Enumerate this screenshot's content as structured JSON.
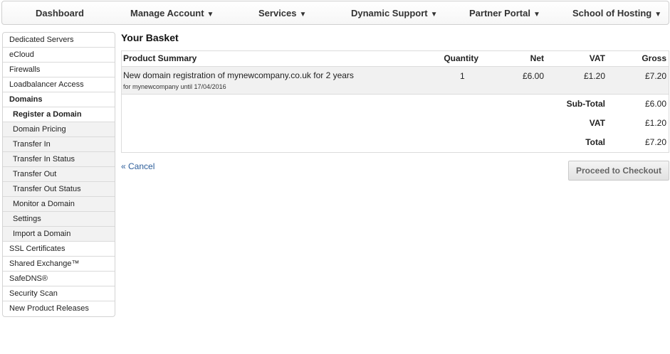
{
  "nav": {
    "items": [
      {
        "label": "Dashboard",
        "caret": ""
      },
      {
        "label": "Manage Account",
        "caret": "▼"
      },
      {
        "label": "Services",
        "caret": "▼"
      },
      {
        "label": "Dynamic Support",
        "caret": "▼"
      },
      {
        "label": "Partner Portal",
        "caret": "▼"
      },
      {
        "label": "School of Hosting",
        "caret": "▼"
      }
    ]
  },
  "sidebar": {
    "items": [
      {
        "label": "Dedicated Servers"
      },
      {
        "label": "eCloud"
      },
      {
        "label": "Firewalls"
      },
      {
        "label": "Loadbalancer Access"
      },
      {
        "label": "Domains"
      },
      {
        "label": "Register a Domain"
      },
      {
        "label": "Domain Pricing"
      },
      {
        "label": "Transfer In"
      },
      {
        "label": "Transfer In Status"
      },
      {
        "label": "Transfer Out"
      },
      {
        "label": "Transfer Out Status"
      },
      {
        "label": "Monitor a Domain"
      },
      {
        "label": "Settings"
      },
      {
        "label": "Import a Domain"
      },
      {
        "label": "SSL Certificates"
      },
      {
        "label": "Shared Exchange™"
      },
      {
        "label": "SafeDNS®"
      },
      {
        "label": "Security Scan"
      },
      {
        "label": "New Product Releases"
      }
    ]
  },
  "basket": {
    "title": "Your Basket",
    "columns": {
      "product": "Product Summary",
      "quantity": "Quantity",
      "net": "Net",
      "vat": "VAT",
      "gross": "Gross"
    },
    "rows": [
      {
        "description": "New domain registration of mynewcompany.co.uk for 2 years",
        "detail": "for mynewcompany until 17/04/2016",
        "quantity": "1",
        "net": "£6.00",
        "vat": "£1.20",
        "gross": "£7.20"
      }
    ],
    "totals": {
      "subtotal_label": "Sub-Total",
      "subtotal": "£6.00",
      "vat_label": "VAT",
      "vat": "£1.20",
      "total_label": "Total",
      "total": "£7.20"
    }
  },
  "actions": {
    "cancel": "« Cancel",
    "checkout": "Proceed to Checkout"
  },
  "colors": {
    "link": "#2c5d9a",
    "row_bg": "#f1f1f1",
    "border": "#dcdcdc"
  }
}
